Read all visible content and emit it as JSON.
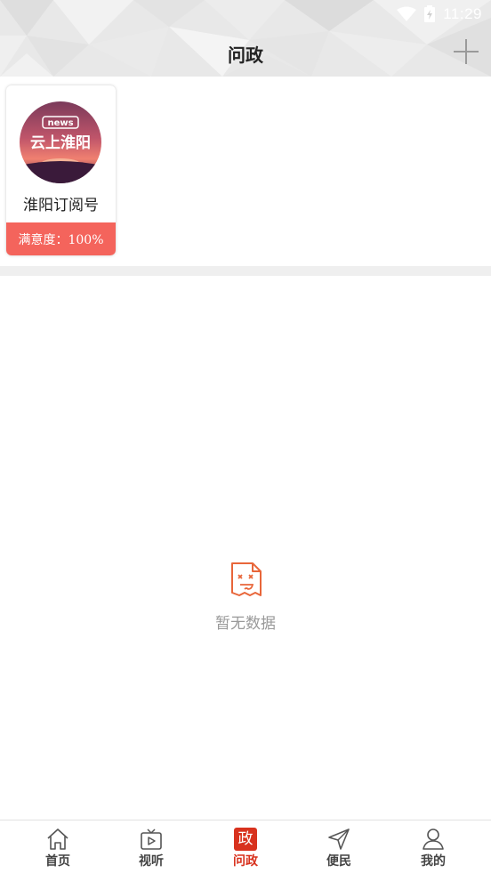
{
  "status_bar": {
    "time": "11:29"
  },
  "header": {
    "title": "问政"
  },
  "account_card": {
    "name": "淮阳订阅号",
    "satisfaction": "满意度：100%",
    "avatar": {
      "top_text": "news",
      "main_text": "云上淮阳"
    }
  },
  "empty_state": {
    "text": "暂无数据"
  },
  "bottom_nav": {
    "items": [
      {
        "label": "首页",
        "icon": "home-icon"
      },
      {
        "label": "视听",
        "icon": "tv-icon"
      },
      {
        "label": "问政",
        "icon": "zheng-badge-icon",
        "badge": "政",
        "active": true
      },
      {
        "label": "便民",
        "icon": "paper-plane-icon"
      },
      {
        "label": "我的",
        "icon": "user-icon"
      }
    ]
  },
  "colors": {
    "accent": "#d8321e",
    "satisfaction_bg": "#f4645c",
    "muted_text": "#999999"
  }
}
